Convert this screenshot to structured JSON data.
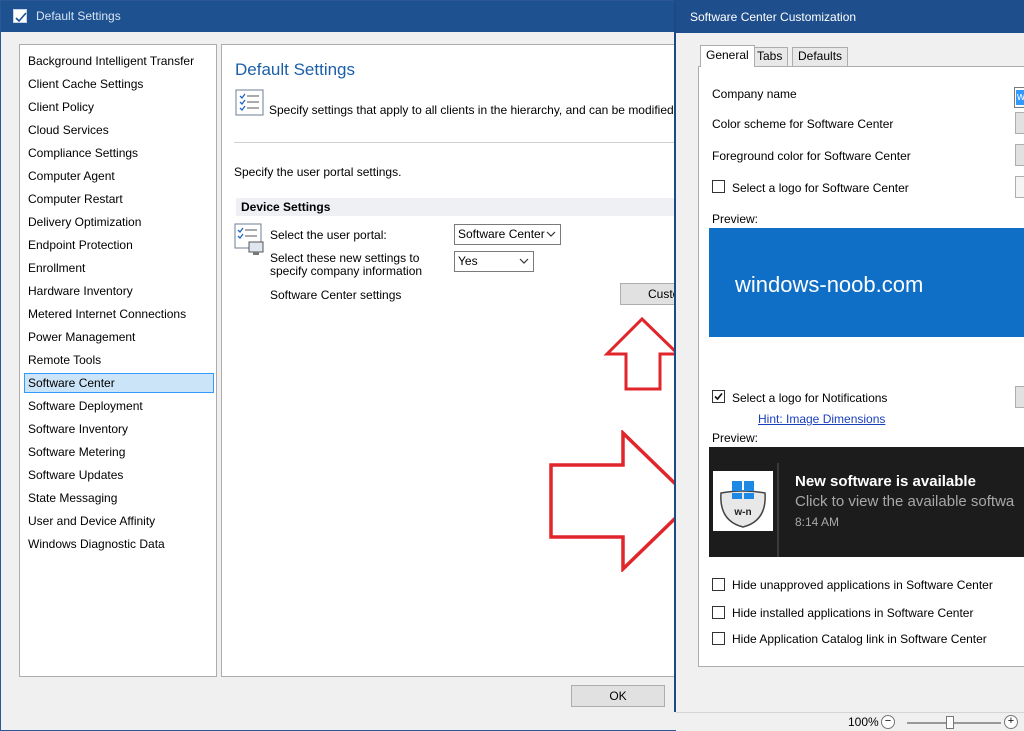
{
  "main_window": {
    "title": "Default Settings",
    "nav_items": [
      "Background Intelligent Transfer",
      "Client Cache Settings",
      "Client Policy",
      "Cloud Services",
      "Compliance Settings",
      "Computer Agent",
      "Computer Restart",
      "Delivery Optimization",
      "Endpoint Protection",
      "Enrollment",
      "Hardware Inventory",
      "Metered Internet Connections",
      "Power Management",
      "Remote Tools",
      "Software Center",
      "Software Deployment",
      "Software Inventory",
      "Software Metering",
      "Software Updates",
      "State Messaging",
      "User and Device Affinity",
      "Windows Diagnostic Data"
    ],
    "selected_nav": "Software Center",
    "content": {
      "heading": "Default Settings",
      "intro": "Specify settings that apply to all clients in the hierarchy, and can be modified by custo",
      "portal_intro": "Specify the user portal settings.",
      "section_header": "Device Settings",
      "portal_label": "Select the user portal:",
      "portal_value": "Software Center",
      "company_label": "Select these new settings to specify company information",
      "company_value": "Yes",
      "sc_settings_label": "Software Center settings",
      "customize_label": "Custo"
    },
    "ok_label": "OK"
  },
  "dialog": {
    "title": "Software Center Customization",
    "tabs": [
      {
        "label": "General",
        "active": true
      },
      {
        "label": "Tabs",
        "active": false
      },
      {
        "label": "Defaults",
        "active": false
      }
    ],
    "company_name_label": "Company name",
    "company_name_value": "wi",
    "color_scheme_label": "Color scheme for Software Center",
    "foreground_color_label": "Foreground color for Software Center",
    "logo_sc_label": "Select a logo for Software Center",
    "logo_sc_checked": false,
    "preview_label": "Preview:",
    "preview_brand_text": "windows-noob.com",
    "preview_color": "#0f6fc6",
    "logo_notifications_label": "Select a logo for Notifications",
    "logo_notifications_checked": true,
    "hint_link": "Hint: Image Dimensions",
    "preview2_label": "Preview:",
    "toast": {
      "logo_text": "w-n",
      "title": "New software is available",
      "subtitle": "Click to view the available softwa",
      "time": "8:14 AM"
    },
    "hide_unapproved_label": "Hide unapproved applications in Software Center",
    "hide_installed_label": "Hide installed applications in Software Center",
    "hide_catalog_label": "Hide Application Catalog link in Software Center"
  },
  "status_bar": {
    "zoom": "100%",
    "zoom_out_icon": "−",
    "zoom_in_icon": "+"
  },
  "colors": {
    "title_bar": "#1e5190",
    "accent_link": "#1a3fbd",
    "annotation_arrow": "#e0262b"
  }
}
